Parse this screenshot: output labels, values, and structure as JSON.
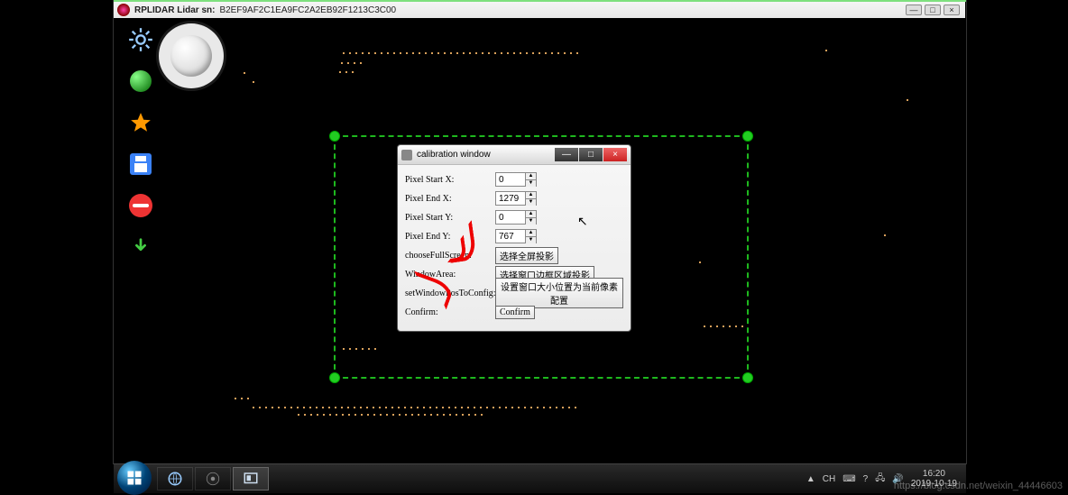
{
  "window": {
    "title_label": "RPLIDAR Lidar sn:",
    "serial": "B2EF9AF2C1EA9FC2A2EB92F1213C3C00"
  },
  "calibration": {
    "title": "calibration window",
    "labels": {
      "pixel_start_x": "Pixel Start X:",
      "pixel_end_x": "Pixel End X:",
      "pixel_start_y": "Pixel Start Y:",
      "pixel_end_y": "Pixel End Y:",
      "choose_full": "chooseFullScreen:",
      "window_area": "WindowArea:",
      "set_config": "setWindowPosToConfig:",
      "confirm": "Confirm:"
    },
    "values": {
      "pixel_start_x": "0",
      "pixel_end_x": "1279",
      "pixel_start_y": "0",
      "pixel_end_y": "767"
    },
    "buttons": {
      "full": "选择全屏投影",
      "area": "选择窗口边框区域投影",
      "setcfg": "设置窗口大小位置为当前像素配置",
      "confirm": "Confirm"
    }
  },
  "tray": {
    "lang": "CH",
    "triangle": "▲",
    "time": "16:20",
    "date": "2019-10-19"
  },
  "watermark": "https://blog.csdn.net/weixin_44446603"
}
